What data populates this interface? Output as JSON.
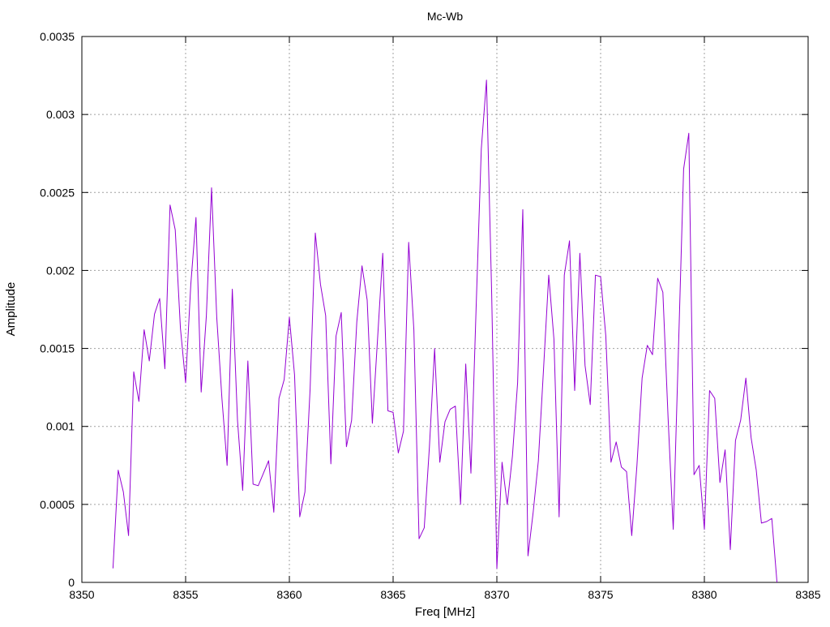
{
  "chart_data": {
    "type": "line",
    "title": "Mc-Wb",
    "xlabel": "Freq [MHz]",
    "ylabel": "Amplitude",
    "xlim": [
      8350,
      8385
    ],
    "ylim": [
      0,
      0.0035
    ],
    "x_ticks": [
      8350,
      8355,
      8360,
      8365,
      8370,
      8375,
      8380,
      8385
    ],
    "x_tick_labels": [
      "8350",
      "8355",
      "8360",
      "8365",
      "8370",
      "8375",
      "8380",
      "8385"
    ],
    "y_ticks": [
      0,
      0.0005,
      0.001,
      0.0015,
      0.002,
      0.0025,
      0.003,
      0.0035
    ],
    "y_tick_labels": [
      "0",
      "0.0005",
      "0.001",
      "0.0015",
      "0.002",
      "0.0025",
      "0.003",
      "0.0035"
    ],
    "grid": true,
    "line_color": "#9400D3",
    "series": [
      {
        "x": [
          8351.5,
          8351.75,
          8352.0,
          8352.25,
          8352.5,
          8352.75,
          8353.0,
          8353.25,
          8353.5,
          8353.75,
          8354.0,
          8354.25,
          8354.5,
          8354.75,
          8355.0,
          8355.25,
          8355.5,
          8355.75,
          8356.0,
          8356.25,
          8356.5,
          8356.75,
          8357.0,
          8357.25,
          8357.5,
          8357.75,
          8358.0,
          8358.25,
          8358.5,
          8358.75,
          8359.0,
          8359.25,
          8359.5,
          8359.75,
          8360.0,
          8360.25,
          8360.5,
          8360.75,
          8361.0,
          8361.25,
          8361.5,
          8361.75,
          8362.0,
          8362.25,
          8362.5,
          8362.75,
          8363.0,
          8363.25,
          8363.5,
          8363.75,
          8364.0,
          8364.25,
          8364.5,
          8364.75,
          8365.0,
          8365.25,
          8365.5,
          8365.75,
          8366.0,
          8366.25,
          8366.5,
          8366.75,
          8367.0,
          8367.25,
          8367.5,
          8367.75,
          8368.0,
          8368.25,
          8368.5,
          8368.75,
          8369.0,
          8369.25,
          8369.5,
          8369.75,
          8370.0,
          8370.25,
          8370.5,
          8370.75,
          8371.0,
          8371.25,
          8371.5,
          8371.75,
          8372.0,
          8372.25,
          8372.5,
          8372.75,
          8373.0,
          8373.25,
          8373.5,
          8373.75,
          8374.0,
          8374.25,
          8374.5,
          8374.75,
          8375.0,
          8375.25,
          8375.5,
          8375.75,
          8376.0,
          8376.25,
          8376.5,
          8376.75,
          8377.0,
          8377.25,
          8377.5,
          8377.75,
          8378.0,
          8378.25,
          8378.5,
          8378.75,
          8379.0,
          8379.25,
          8379.5,
          8379.75,
          8380.0,
          8380.25,
          8380.5,
          8380.75,
          8381.0,
          8381.25,
          8381.5,
          8381.75,
          8382.0,
          8382.25,
          8382.5,
          8382.75,
          8383.0,
          8383.25,
          8383.5
        ],
        "values": [
          9e-05,
          0.00072,
          0.00058,
          0.0003,
          0.00135,
          0.00116,
          0.00162,
          0.00142,
          0.00172,
          0.00182,
          0.00137,
          0.00242,
          0.00226,
          0.00163,
          0.00128,
          0.00191,
          0.00234,
          0.00122,
          0.00171,
          0.00253,
          0.0017,
          0.00118,
          0.00075,
          0.00188,
          0.00104,
          0.00059,
          0.00142,
          0.00063,
          0.00062,
          0.0007,
          0.00078,
          0.00045,
          0.00118,
          0.0013,
          0.0017,
          0.00133,
          0.00042,
          0.00058,
          0.00124,
          0.00224,
          0.00191,
          0.00171,
          0.00076,
          0.00158,
          0.00173,
          0.00087,
          0.00104,
          0.00167,
          0.00203,
          0.00181,
          0.00102,
          0.00156,
          0.00211,
          0.0011,
          0.00109,
          0.00083,
          0.00097,
          0.00218,
          0.00162,
          0.00028,
          0.00035,
          0.00087,
          0.0015,
          0.00077,
          0.00103,
          0.00111,
          0.00113,
          0.0005,
          0.0014,
          0.0007,
          0.00176,
          0.00278,
          0.00322,
          0.00185,
          9e-05,
          0.00077,
          0.0005,
          0.00081,
          0.00128,
          0.00239,
          0.00017,
          0.00045,
          0.00078,
          0.00137,
          0.00197,
          0.00156,
          0.00042,
          0.00197,
          0.00219,
          0.00123,
          0.00211,
          0.00139,
          0.00114,
          0.00197,
          0.00196,
          0.00158,
          0.00077,
          0.0009,
          0.00074,
          0.00071,
          0.0003,
          0.00075,
          0.00131,
          0.00152,
          0.00146,
          0.00195,
          0.00186,
          0.00106,
          0.00034,
          0.00149,
          0.00265,
          0.00288,
          0.00069,
          0.00075,
          0.00034,
          0.00123,
          0.00118,
          0.00064,
          0.00085,
          0.00021,
          0.00091,
          0.00104,
          0.00131,
          0.00093,
          0.00072,
          0.00038,
          0.00039,
          0.00041,
          0.0
        ]
      }
    ]
  }
}
